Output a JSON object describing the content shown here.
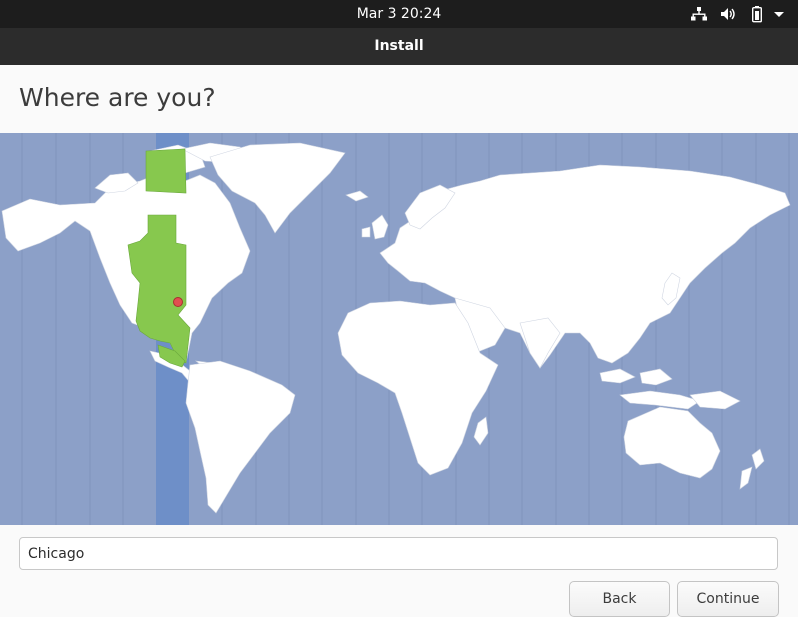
{
  "top_bar": {
    "datetime": "Mar 3  20:24",
    "icons": [
      "network-icon",
      "volume-icon",
      "battery-icon",
      "system-menu-icon"
    ]
  },
  "window": {
    "title": "Install"
  },
  "page": {
    "title": "Where are you?"
  },
  "map": {
    "selected_city": "Chicago",
    "highlight_color": "#87c84e",
    "band_color": "#6e8fc8",
    "ocean_color": "#8ca0c8",
    "land_color": "#ffffff",
    "marker_color": "#e05050"
  },
  "timezone_input": {
    "value": "Chicago"
  },
  "buttons": {
    "back": "Back",
    "continue": "Continue"
  }
}
